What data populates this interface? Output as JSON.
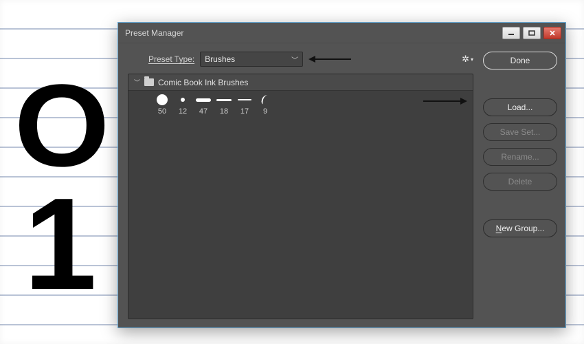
{
  "window": {
    "title": "Preset Manager"
  },
  "type_row": {
    "label": "Preset Type:",
    "selected": "Brushes"
  },
  "group": {
    "name": "Comic Book Ink Brushes"
  },
  "brushes": {
    "b0": {
      "size": "50"
    },
    "b1": {
      "size": "12"
    },
    "b2": {
      "size": "47"
    },
    "b3": {
      "size": "18"
    },
    "b4": {
      "size": "17"
    },
    "b5": {
      "size": "9"
    }
  },
  "buttons": {
    "done": "Done",
    "load": "Load...",
    "save_set": "Save Set...",
    "rename": "Rename...",
    "delete": "Delete",
    "new_group_prefix": "N",
    "new_group_rest": "ew Group..."
  }
}
